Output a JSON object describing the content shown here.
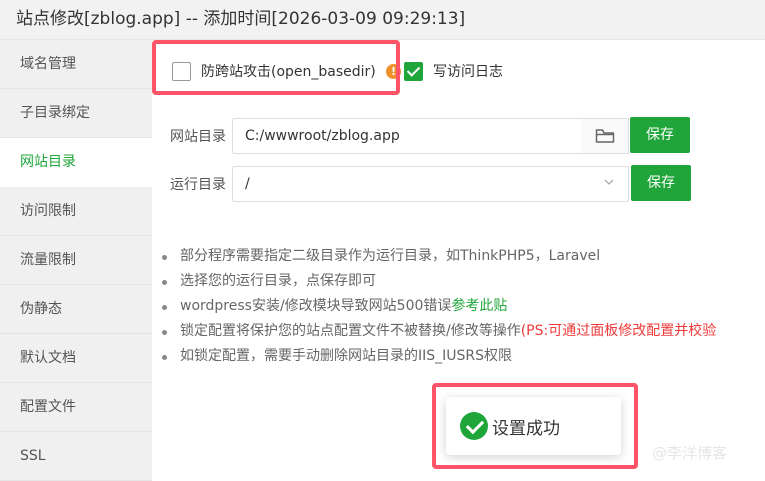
{
  "window": {
    "title": "站点修改[zblog.app] -- 添加时间[2026-03-09 09:29:13]"
  },
  "sidebar": {
    "items": [
      {
        "label": "域名管理"
      },
      {
        "label": "子目录绑定"
      },
      {
        "label": "网站目录",
        "active": true
      },
      {
        "label": "访问限制"
      },
      {
        "label": "流量限制"
      },
      {
        "label": "伪静态"
      },
      {
        "label": "默认文档"
      },
      {
        "label": "配置文件"
      },
      {
        "label": "SSL"
      }
    ]
  },
  "options": {
    "anti_xss_label": "防跨站攻击(open_basedir)",
    "anti_xss_checked": false,
    "help_icon": "help-icon",
    "access_log_label": "写访问日志",
    "access_log_checked": true
  },
  "site_dir": {
    "label": "网站目录",
    "value": "C:/wwwroot/zblog.app",
    "folder_icon": "folder-icon",
    "save_label": "保存"
  },
  "run_dir": {
    "label": "运行目录",
    "value": "/",
    "save_label": "保存"
  },
  "tips": {
    "item1": "部分程序需要指定二级目录作为运行目录，如ThinkPHP5，Laravel",
    "item2": "选择您的运行目录，点保存即可",
    "item3_prefix": "wordpress安装/修改模块导致网站500错误",
    "item3_link": "参考此贴",
    "item4_prefix": "锁定配置将保护您的站点配置文件不被替换/修改等操作",
    "item4_red": "(PS:可通过面板修改配置并校验",
    "item5": "如锁定配置，需要手动删除网站目录的IIS_IUSRS权限"
  },
  "toast": {
    "message": "设置成功"
  },
  "watermark": {
    "text": "@李洋博客"
  },
  "colors": {
    "accent": "#20a53a",
    "highlight_box": "#ff5468",
    "warning": "#ef3a3a",
    "help": "#f0902a"
  }
}
